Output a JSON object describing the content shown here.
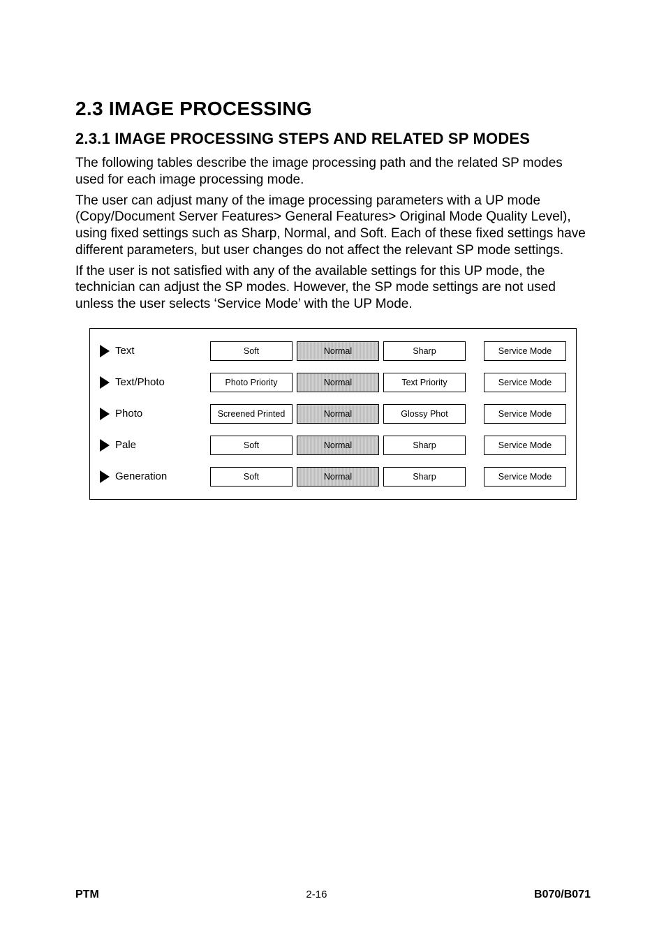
{
  "heading": "2.3  IMAGE PROCESSING",
  "subheading": "2.3.1  IMAGE PROCESSING STEPS AND RELATED SP MODES",
  "p1": "The following tables describe the image processing path and the related SP modes used for each image processing mode.",
  "p2": "The user can adjust many of the image processing parameters with a UP mode (Copy/Document Server Features> General Features> Original Mode Quality Level), using fixed settings such as Sharp, Normal, and Soft. Each of these fixed settings have different parameters, but user changes do not affect the relevant SP mode settings.",
  "p3": "If the user is not satisfied with any of the available settings for this UP mode, the technician can adjust the SP modes. However, the SP mode settings are not used unless the user selects ‘Service Mode’ with the UP Mode.",
  "rows": [
    {
      "mode": "Text",
      "c1": "Soft",
      "c2": "Normal",
      "c3": "Sharp",
      "c4": "Service Mode"
    },
    {
      "mode": "Text/Photo",
      "c1": "Photo Priority",
      "c2": "Normal",
      "c3": "Text Priority",
      "c4": "Service Mode"
    },
    {
      "mode": "Photo",
      "c1": "Screened Printed",
      "c2": "Normal",
      "c3": "Glossy Phot",
      "c4": "Service Mode"
    },
    {
      "mode": "Pale",
      "c1": "Soft",
      "c2": "Normal",
      "c3": "Sharp",
      "c4": "Service Mode"
    },
    {
      "mode": "Generation",
      "c1": "Soft",
      "c2": "Normal",
      "c3": "Sharp",
      "c4": "Service Mode"
    }
  ],
  "footer": {
    "left": "PTM",
    "center": "2-16",
    "right": "B070/B071"
  }
}
